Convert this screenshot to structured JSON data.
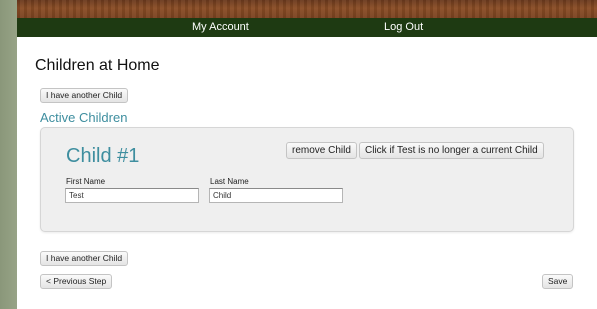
{
  "nav": {
    "my_account": "My Account",
    "log_out": "Log Out"
  },
  "page": {
    "title": "Children at Home",
    "add_child_label": "I have another Child",
    "section_heading": "Active Children",
    "previous_label": "< Previous Step",
    "save_label": "Save"
  },
  "child": {
    "title": "Child #1",
    "remove_label": "remove Child",
    "not_current_label": "Click if Test is no longer a current Child",
    "first_name_label": "First Name",
    "first_name_value": "Test",
    "last_name_label": "Last Name",
    "last_name_value": "Child"
  },
  "colors": {
    "navbar": "#1e3a12",
    "accent_teal": "#3e8e9f",
    "side_background": "#8d9a7c"
  }
}
